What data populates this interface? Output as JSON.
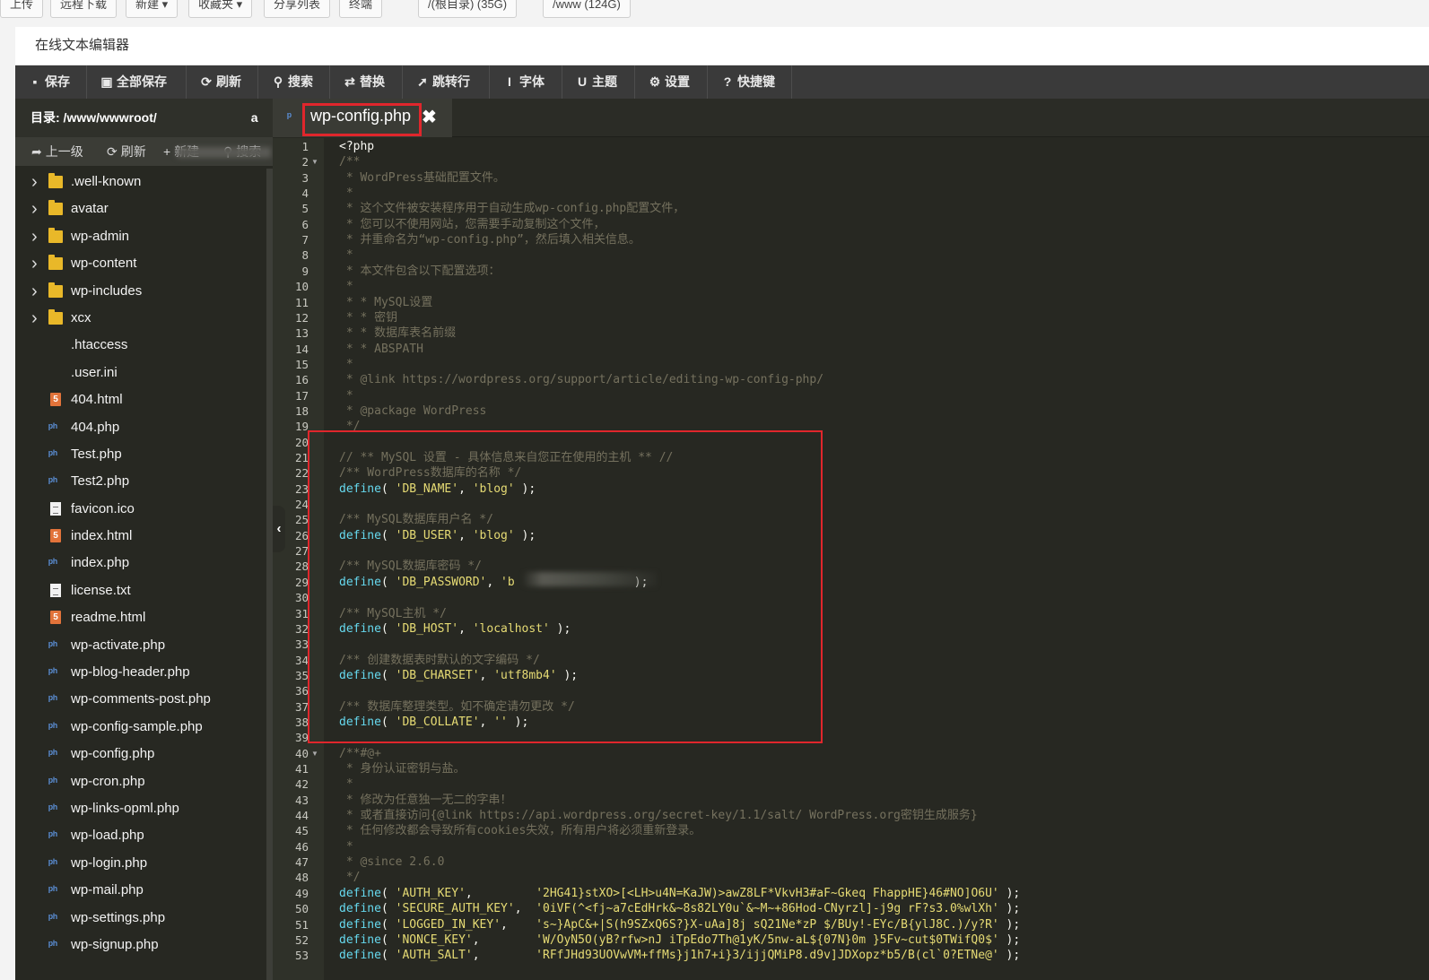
{
  "page_toolbar": {
    "buttons": [
      "上传",
      "远程下载",
      "新建 ▾",
      "收藏夹 ▾",
      "分享列表",
      "终端",
      "/(根目录) (35G)",
      "/www (124G)"
    ]
  },
  "window": {
    "title": "在线文本编辑器"
  },
  "toolbar": {
    "items": [
      {
        "icon": "save-icon",
        "glyph": "▪",
        "label": "保存"
      },
      {
        "icon": "save-all-icon",
        "glyph": "▣",
        "label": "全部保存"
      },
      {
        "icon": "refresh-icon",
        "glyph": "⟳",
        "label": "刷新"
      },
      {
        "icon": "search-icon",
        "glyph": "⚲",
        "label": "搜索"
      },
      {
        "icon": "replace-icon",
        "glyph": "⇄",
        "label": "替换"
      },
      {
        "icon": "goto-line-icon",
        "glyph": "➚",
        "label": "跳转行"
      },
      {
        "icon": "font-icon",
        "glyph": "I",
        "label": "字体"
      },
      {
        "icon": "theme-icon",
        "glyph": "U",
        "label": "主题"
      },
      {
        "icon": "settings-icon",
        "glyph": "⚙",
        "label": "设置"
      },
      {
        "icon": "help-icon",
        "glyph": "?",
        "label": "快捷键"
      }
    ]
  },
  "sidebar": {
    "path_label": "目录: /www/wwwroot/",
    "path_suffix": "a",
    "actions": [
      {
        "icon": "up-level-icon",
        "glyph": "➦",
        "label": "上一级"
      },
      {
        "icon": "refresh-icon",
        "glyph": "⟳",
        "label": "刷新"
      },
      {
        "icon": "plus-icon",
        "glyph": "+",
        "label": "新建"
      },
      {
        "icon": "search-icon",
        "glyph": "⚲",
        "label": "搜索"
      }
    ],
    "files": [
      {
        "name": ".well-known",
        "type": "folder"
      },
      {
        "name": "avatar",
        "type": "folder"
      },
      {
        "name": "wp-admin",
        "type": "folder"
      },
      {
        "name": "wp-content",
        "type": "folder"
      },
      {
        "name": "wp-includes",
        "type": "folder"
      },
      {
        "name": "xcx",
        "type": "folder"
      },
      {
        "name": ".htaccess",
        "type": "plain"
      },
      {
        "name": ".user.ini",
        "type": "plain"
      },
      {
        "name": "404.html",
        "type": "html"
      },
      {
        "name": "404.php",
        "type": "php"
      },
      {
        "name": "Test.php",
        "type": "php"
      },
      {
        "name": "Test2.php",
        "type": "php"
      },
      {
        "name": "favicon.ico",
        "type": "txt"
      },
      {
        "name": "index.html",
        "type": "html"
      },
      {
        "name": "index.php",
        "type": "php"
      },
      {
        "name": "license.txt",
        "type": "txt"
      },
      {
        "name": "readme.html",
        "type": "html"
      },
      {
        "name": "wp-activate.php",
        "type": "php"
      },
      {
        "name": "wp-blog-header.php",
        "type": "php"
      },
      {
        "name": "wp-comments-post.php",
        "type": "php"
      },
      {
        "name": "wp-config-sample.php",
        "type": "php"
      },
      {
        "name": "wp-config.php",
        "type": "php"
      },
      {
        "name": "wp-cron.php",
        "type": "php"
      },
      {
        "name": "wp-links-opml.php",
        "type": "php"
      },
      {
        "name": "wp-load.php",
        "type": "php"
      },
      {
        "name": "wp-login.php",
        "type": "php"
      },
      {
        "name": "wp-mail.php",
        "type": "php"
      },
      {
        "name": "wp-settings.php",
        "type": "php"
      },
      {
        "name": "wp-signup.php",
        "type": "php"
      }
    ]
  },
  "editor": {
    "tab": {
      "label": "wp-config.php",
      "close_glyph": "✖"
    },
    "fold_lines": [
      2,
      40
    ],
    "lines": [
      [
        [
          "p",
          "<?php"
        ]
      ],
      [
        [
          "c",
          "/**"
        ]
      ],
      [
        [
          "c",
          " * WordPress基础配置文件。"
        ]
      ],
      [
        [
          "c",
          " *"
        ]
      ],
      [
        [
          "c",
          " * 这个文件被安装程序用于自动生成wp-config.php配置文件，"
        ]
      ],
      [
        [
          "c",
          " * 您可以不使用网站，您需要手动复制这个文件，"
        ]
      ],
      [
        [
          "c",
          " * 并重命名为“wp-config.php”，然后填入相关信息。"
        ]
      ],
      [
        [
          "c",
          " *"
        ]
      ],
      [
        [
          "c",
          " * 本文件包含以下配置选项："
        ]
      ],
      [
        [
          "c",
          " *"
        ]
      ],
      [
        [
          "c",
          " * * MySQL设置"
        ]
      ],
      [
        [
          "c",
          " * * 密钥"
        ]
      ],
      [
        [
          "c",
          " * * 数据库表名前缀"
        ]
      ],
      [
        [
          "c",
          " * * ABSPATH"
        ]
      ],
      [
        [
          "c",
          " *"
        ]
      ],
      [
        [
          "c",
          " * @link https://wordpress.org/support/article/editing-wp-config-php/"
        ]
      ],
      [
        [
          "c",
          " *"
        ]
      ],
      [
        [
          "c",
          " * @package WordPress"
        ]
      ],
      [
        [
          "c",
          " */"
        ]
      ],
      [],
      [
        [
          "c",
          "// ** MySQL 设置 - 具体信息来自您正在使用的主机 ** //"
        ]
      ],
      [
        [
          "c",
          "/** WordPress数据库的名称 */"
        ]
      ],
      [
        [
          "k",
          "define"
        ],
        [
          "p",
          "( "
        ],
        [
          "s",
          "'DB_NAME'"
        ],
        [
          "p",
          ", "
        ],
        [
          "s",
          "'blog'"
        ],
        [
          "p",
          " );"
        ]
      ],
      [],
      [
        [
          "c",
          "/** MySQL数据库用户名 */"
        ]
      ],
      [
        [
          "k",
          "define"
        ],
        [
          "p",
          "( "
        ],
        [
          "s",
          "'DB_USER'"
        ],
        [
          "p",
          ", "
        ],
        [
          "s",
          "'blog'"
        ],
        [
          "p",
          " );"
        ]
      ],
      [],
      [
        [
          "c",
          "/** MySQL数据库密码 */"
        ]
      ],
      [
        [
          "k",
          "define"
        ],
        [
          "p",
          "( "
        ],
        [
          "s",
          "'DB_PASSWORD'"
        ],
        [
          "p",
          ", "
        ],
        [
          "s",
          "'b"
        ],
        [
          "p",
          "                 );"
        ]
      ],
      [],
      [
        [
          "c",
          "/** MySQL主机 */"
        ]
      ],
      [
        [
          "k",
          "define"
        ],
        [
          "p",
          "( "
        ],
        [
          "s",
          "'DB_HOST'"
        ],
        [
          "p",
          ", "
        ],
        [
          "s",
          "'localhost'"
        ],
        [
          "p",
          " );"
        ]
      ],
      [],
      [
        [
          "c",
          "/** 创建数据表时默认的文字编码 */"
        ]
      ],
      [
        [
          "k",
          "define"
        ],
        [
          "p",
          "( "
        ],
        [
          "s",
          "'DB_CHARSET'"
        ],
        [
          "p",
          ", "
        ],
        [
          "s",
          "'utf8mb4'"
        ],
        [
          "p",
          " );"
        ]
      ],
      [],
      [
        [
          "c",
          "/** 数据库整理类型。如不确定请勿更改 */"
        ]
      ],
      [
        [
          "k",
          "define"
        ],
        [
          "p",
          "( "
        ],
        [
          "s",
          "'DB_COLLATE'"
        ],
        [
          "p",
          ", "
        ],
        [
          "s",
          "''"
        ],
        [
          "p",
          " );"
        ]
      ],
      [],
      [
        [
          "c",
          "/**#@+"
        ]
      ],
      [
        [
          "c",
          " * 身份认证密钥与盐。"
        ]
      ],
      [
        [
          "c",
          " *"
        ]
      ],
      [
        [
          "c",
          " * 修改为任意独一无二的字串！"
        ]
      ],
      [
        [
          "c",
          " * 或者直接访问{@link https://api.wordpress.org/secret-key/1.1/salt/ WordPress.org密钥生成服务}"
        ]
      ],
      [
        [
          "c",
          " * 任何修改都会导致所有cookies失效，所有用户将必须重新登录。"
        ]
      ],
      [
        [
          "c",
          " *"
        ]
      ],
      [
        [
          "c",
          " * @since 2.6.0"
        ]
      ],
      [
        [
          "c",
          " */"
        ]
      ],
      [
        [
          "k",
          "define"
        ],
        [
          "p",
          "( "
        ],
        [
          "s",
          "'AUTH_KEY'"
        ],
        [
          "p",
          ",         "
        ],
        [
          "s",
          "'2HG41}stXO>[<LH>u4N=KaJW)>awZ8LF*VkvH3#aF~Gkeq FhappHE}46#NO]O6U'"
        ],
        [
          "p",
          " );"
        ]
      ],
      [
        [
          "k",
          "define"
        ],
        [
          "p",
          "( "
        ],
        [
          "s",
          "'SECURE_AUTH_KEY'"
        ],
        [
          "p",
          ",  "
        ],
        [
          "s",
          "'0iVF(^<fj~a7cEdHrk&~8s82LY0u`&~M~+86Hod-CNyrzl]-j9g rF?s3.0%wlXh'"
        ],
        [
          "p",
          " );"
        ]
      ],
      [
        [
          "k",
          "define"
        ],
        [
          "p",
          "( "
        ],
        [
          "s",
          "'LOGGED_IN_KEY'"
        ],
        [
          "p",
          ",    "
        ],
        [
          "s",
          "'s~}ApC&+|S(h9SZxQ6S?}X-uAa]8j sQ21Ne*zP $/BUy!-EYc/B{ylJ8C.)/y?R'"
        ],
        [
          "p",
          " );"
        ]
      ],
      [
        [
          "k",
          "define"
        ],
        [
          "p",
          "( "
        ],
        [
          "s",
          "'NONCE_KEY'"
        ],
        [
          "p",
          ",        "
        ],
        [
          "s",
          "'W/OyN5O(yB?rfw>nJ iTpEdo7Th@1yK/5nw-aL${07N}0m }5Fv~cut$0TWifQ0$'"
        ],
        [
          "p",
          " );"
        ]
      ],
      [
        [
          "k",
          "define"
        ],
        [
          "p",
          "( "
        ],
        [
          "s",
          "'AUTH_SALT'"
        ],
        [
          "p",
          ",        "
        ],
        [
          "s",
          "'RFfJHd93UOVwVM+ffMs}j1h7+i}3/ijjQMiP8.d9v]JDXopz*b5/B(cl`0?ETNe@'"
        ],
        [
          "p",
          " );"
        ]
      ]
    ]
  }
}
